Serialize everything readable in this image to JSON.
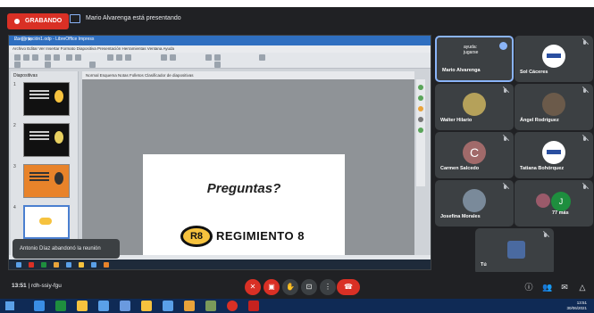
{
  "header": {
    "recording_label": "GRABANDO",
    "presenting_text": "Mario Alvarenga está presentando"
  },
  "impress": {
    "window_title": "Presentación1.odp - LibreOffice Impress",
    "menu_text": "Archivo  Editar  Ver  Insertar  Formato  Diapositiva  Presentación  Herramientas  Ventana  Ayuda",
    "pane_title": "Diapositivas",
    "tabs_text": "Normal  Esquema  Notas  Folletos  Clasificador de diapositivas",
    "slide_numbers": [
      "1",
      "2",
      "3",
      "4"
    ],
    "slide_title": "Preguntas?",
    "logo_mark": "R8",
    "logo_text": "REGIMIENTO 8",
    "window_controls": "—  ☐  ✕"
  },
  "toast": {
    "text": "Antonio Díaz abandonó la reunión"
  },
  "participants": [
    {
      "name": "Mario Alvarenga",
      "label": "ayuda:\njugarse"
    },
    {
      "name": "Sol Cáceres"
    },
    {
      "name": "Walter Hilario"
    },
    {
      "name": "Ángel Rodríguez"
    },
    {
      "name": "Carmen Salcedo",
      "initial": "C"
    },
    {
      "name": "Tatiana Bohórquez"
    },
    {
      "name": "Josefina Morales"
    },
    {
      "name": "77 más",
      "initial": "J"
    },
    {
      "name": "Tú"
    }
  ],
  "bottom": {
    "time": "13:51",
    "meeting_code": "rdh-ssiy-fgu"
  },
  "taskbar": {
    "time": "13:51",
    "date": "30/06/2021"
  },
  "colors": {
    "danger": "#d93025",
    "accent": "#8ab4f8",
    "meet_bg": "#202124",
    "tile_bg": "#3c4043"
  },
  "icons": [
    "record-icon",
    "present-icon",
    "mic-off-icon",
    "camera-off-icon",
    "hand-icon",
    "present-now-icon",
    "more-icon",
    "hang-up-icon",
    "info-icon",
    "people-icon",
    "chat-icon",
    "activities-icon"
  ]
}
